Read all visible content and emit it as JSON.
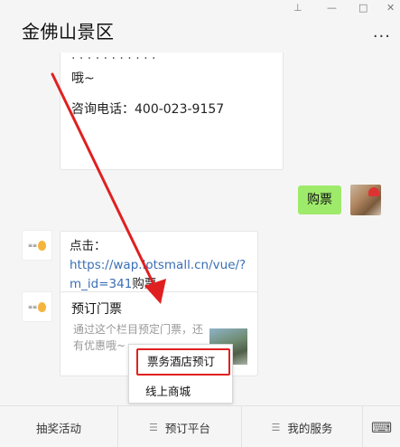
{
  "window": {
    "title": "金佛山景区",
    "controls": [
      "⊥",
      "—",
      "□",
      "✕"
    ],
    "more": "···"
  },
  "messages": {
    "top_partial": "· · · · · · · · · · ·",
    "top_line2": "哦~",
    "top_phone": "咨询电话：400-023-9157",
    "user_msg": "购票",
    "link_prefix": "点击：",
    "link_url": "https://wap.lotsmall.cn/vue/?m_id=341",
    "link_suffix": "购票",
    "card": {
      "title": "预订门票",
      "desc": "通过这个栏目预定门票，还有优惠哦~"
    }
  },
  "popup_menu": {
    "items": [
      "票务酒店预订",
      "线上商城"
    ]
  },
  "bottom_menu": {
    "tabs": [
      "抽奖活动",
      "预订平台",
      "我的服务"
    ]
  },
  "colors": {
    "user_bubble": "#9eea6a",
    "link": "#3a6fb5",
    "annotation_red": "#e02020"
  }
}
